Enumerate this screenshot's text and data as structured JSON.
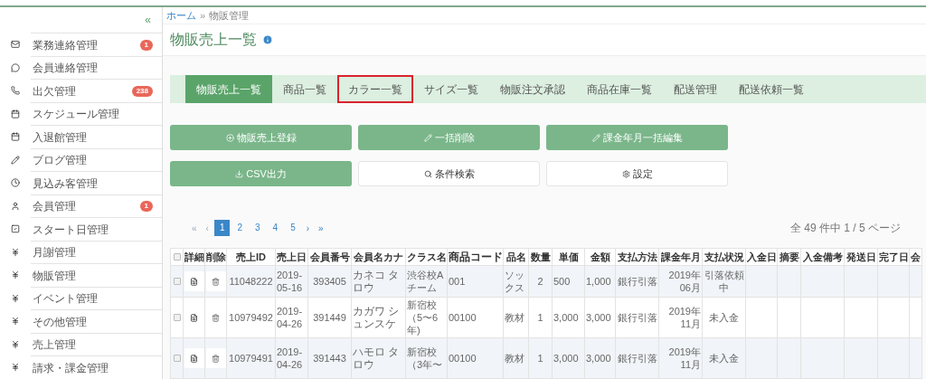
{
  "sidebar": {
    "collapse": "«",
    "items": [
      {
        "label": "業務連絡管理",
        "badge": "1"
      },
      {
        "label": "会員連絡管理"
      },
      {
        "label": "出欠管理",
        "badge": "238"
      },
      {
        "label": "スケジュール管理"
      },
      {
        "label": "入退館管理"
      },
      {
        "label": "ブログ管理"
      },
      {
        "label": "見込み客管理"
      },
      {
        "label": "会員管理",
        "badge": "1"
      },
      {
        "label": "スタート日管理"
      },
      {
        "label": "月謝管理"
      },
      {
        "label": "物販管理"
      },
      {
        "label": "イベント管理"
      },
      {
        "label": "その他管理"
      },
      {
        "label": "売上管理"
      },
      {
        "label": "請求・課金管理"
      }
    ]
  },
  "breadcrumb": {
    "home": "ホーム",
    "separator": "»",
    "current": "物販管理"
  },
  "title": "物販売上一覧",
  "tabs": [
    {
      "label": "物販売上一覧",
      "selected": true,
      "marked": false
    },
    {
      "label": "商品一覧",
      "selected": false,
      "marked": false
    },
    {
      "label": "カラー一覧",
      "selected": false,
      "marked": true
    },
    {
      "label": "サイズ一覧",
      "selected": false,
      "marked": false
    },
    {
      "label": "物販注文承認",
      "selected": false,
      "marked": false
    },
    {
      "label": "商品在庫一覧",
      "selected": false,
      "marked": false
    },
    {
      "label": "配送管理",
      "selected": false,
      "marked": false
    },
    {
      "label": "配送依頼一覧",
      "selected": false,
      "marked": false
    }
  ],
  "actions": [
    {
      "label": "物販売上登録",
      "kind": "primary"
    },
    {
      "label": "一括削除",
      "kind": "primary"
    },
    {
      "label": "課金年月一括編集",
      "kind": "primary"
    },
    {
      "label": "CSV出力",
      "kind": "primary"
    },
    {
      "label": "条件検索",
      "kind": "default"
    },
    {
      "label": "設定",
      "kind": "default"
    }
  ],
  "pagination": {
    "first": "«",
    "prev": "‹",
    "next": "›",
    "last": "»",
    "pages": [
      {
        "label": "1",
        "selected": true
      },
      {
        "label": "2",
        "selected": false
      },
      {
        "label": "3",
        "selected": false
      },
      {
        "label": "4",
        "selected": false
      },
      {
        "label": "5",
        "selected": false
      }
    ],
    "summary": "全 49 件中 1 / 5 ページ"
  },
  "table": {
    "header_checked": false,
    "action_columns": [
      "詳細",
      "削除"
    ],
    "columns": [
      "売上ID",
      "売上日",
      "会員番号",
      "会員名カナ",
      "クラス名",
      "商品コード",
      "品名",
      "数量",
      "単価",
      "金額",
      "支払方法",
      "課金年月",
      "支払状況",
      "入金日",
      "摘要",
      "入金備考",
      "発送日",
      "完了日",
      "会"
    ],
    "rows": [
      {
        "checked": false,
        "cells": [
          "11048222",
          "2019-05-16",
          "393405",
          "カネコ タロウ",
          "渋谷校Aチーム",
          "001",
          "ソックス",
          "2",
          "500",
          "1,000",
          "銀行引落",
          "2019年06月",
          "引落依頼中"
        ]
      },
      {
        "checked": false,
        "cells": [
          "10979492",
          "2019-04-26",
          "391449",
          "カガワ シュンスケ",
          "新宿校（5〜6年)",
          "00100",
          "教材",
          "1",
          "3,000",
          "3,000",
          "銀行引落",
          "2019年11月",
          "未入金"
        ]
      },
      {
        "checked": false,
        "cells": [
          "10979491",
          "2019-04-26",
          "391443",
          "ハモロ タロウ",
          "新宿校（3年〜",
          "00100",
          "教材",
          "1",
          "3,000",
          "3,000",
          "銀行引落",
          "2019年11月",
          "未入金"
        ]
      }
    ]
  }
}
